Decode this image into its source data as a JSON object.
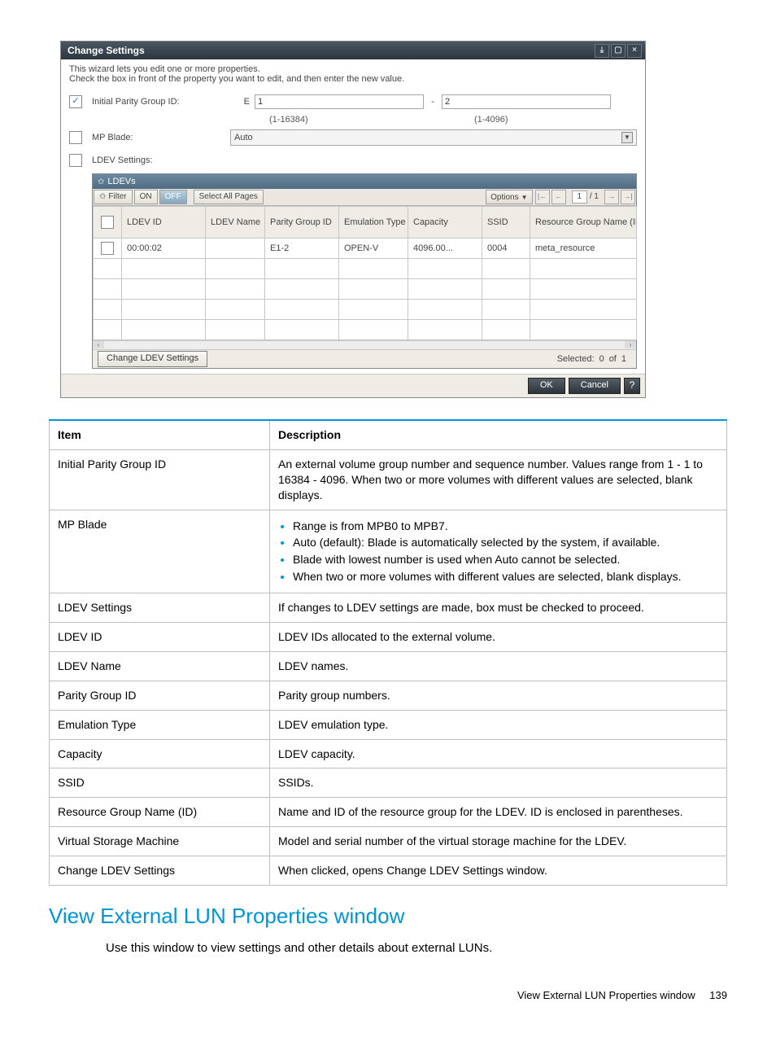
{
  "dialog": {
    "title": "Change Settings",
    "help1": "This wizard lets you edit one or more properties.",
    "help2": "Check the  box in front of the property you want to edit, and then enter the new value.",
    "fields": {
      "initial_pg_label": "Initial Parity Group ID:",
      "e_label": "E",
      "val1": "1",
      "range1": "(1-16384)",
      "dash": "-",
      "val2": "2",
      "range2": "(1-4096)",
      "mp_blade_label": "MP Blade:",
      "mp_blade_value": "Auto",
      "ldev_settings_label": "LDEV Settings:"
    },
    "panel": {
      "title": "LDEVs",
      "filter": "Filter",
      "on": "ON",
      "off": "OFF",
      "select_all": "Select All Pages",
      "options": "Options",
      "page_current": "1",
      "page_total": "/ 1",
      "headers": {
        "ldev_id": "LDEV ID",
        "ldev_name": "LDEV Name",
        "pgroup": "Parity Group ID",
        "emul": "Emulation Type",
        "cap": "Capacity",
        "ssid": "SSID",
        "rg": "Resource Group Name (ID)"
      },
      "rows": [
        {
          "ldev_id": "00:00:02",
          "ldev_name": "",
          "pgroup": "E1-2",
          "emul": "OPEN-V",
          "cap": "4096.00...",
          "ssid": "0004",
          "rg": "meta_resource"
        }
      ],
      "change_btn": "Change LDEV Settings",
      "selected_label": "Selected:",
      "selected_count": "0",
      "of_label": "of",
      "total_count": "1"
    },
    "ok": "OK",
    "cancel": "Cancel"
  },
  "desc_table": {
    "head_item": "Item",
    "head_desc": "Description",
    "rows": [
      {
        "item": "Initial Parity Group ID",
        "desc": "An external volume group number and sequence number. Values range from 1 - 1 to 16384 - 4096. When two or more volumes with different values are selected, blank displays."
      },
      {
        "item": "MP Blade",
        "desc_list": [
          "Range is from MPB0 to MPB7.",
          "Auto (default): Blade is automatically selected by the system, if available.",
          "Blade with lowest number is used when Auto cannot be selected.",
          "When two or more volumes with different values are selected, blank displays."
        ]
      },
      {
        "item": "LDEV Settings",
        "desc": "If changes to LDEV settings are made, box must be checked to proceed."
      },
      {
        "item": "LDEV ID",
        "desc": "LDEV IDs allocated to the external volume."
      },
      {
        "item": "LDEV Name",
        "desc": "LDEV names."
      },
      {
        "item": "Parity Group ID",
        "desc": "Parity group numbers."
      },
      {
        "item": "Emulation Type",
        "desc": "LDEV emulation type."
      },
      {
        "item": "Capacity",
        "desc": "LDEV capacity."
      },
      {
        "item": "SSID",
        "desc": "SSIDs."
      },
      {
        "item": "Resource Group Name (ID)",
        "desc": "Name and ID of the resource group for the LDEV. ID is enclosed in parentheses."
      },
      {
        "item": "Virtual Storage Machine",
        "desc": "Model and serial number of the virtual storage machine for the LDEV."
      },
      {
        "item": "Change LDEV Settings",
        "desc": "When clicked, opens Change LDEV Settings window."
      }
    ]
  },
  "heading": "View External LUN Properties window",
  "heading_text": "Use this window to view settings and other details about external LUNs.",
  "footer_text": "View External LUN Properties window",
  "footer_page": "139"
}
